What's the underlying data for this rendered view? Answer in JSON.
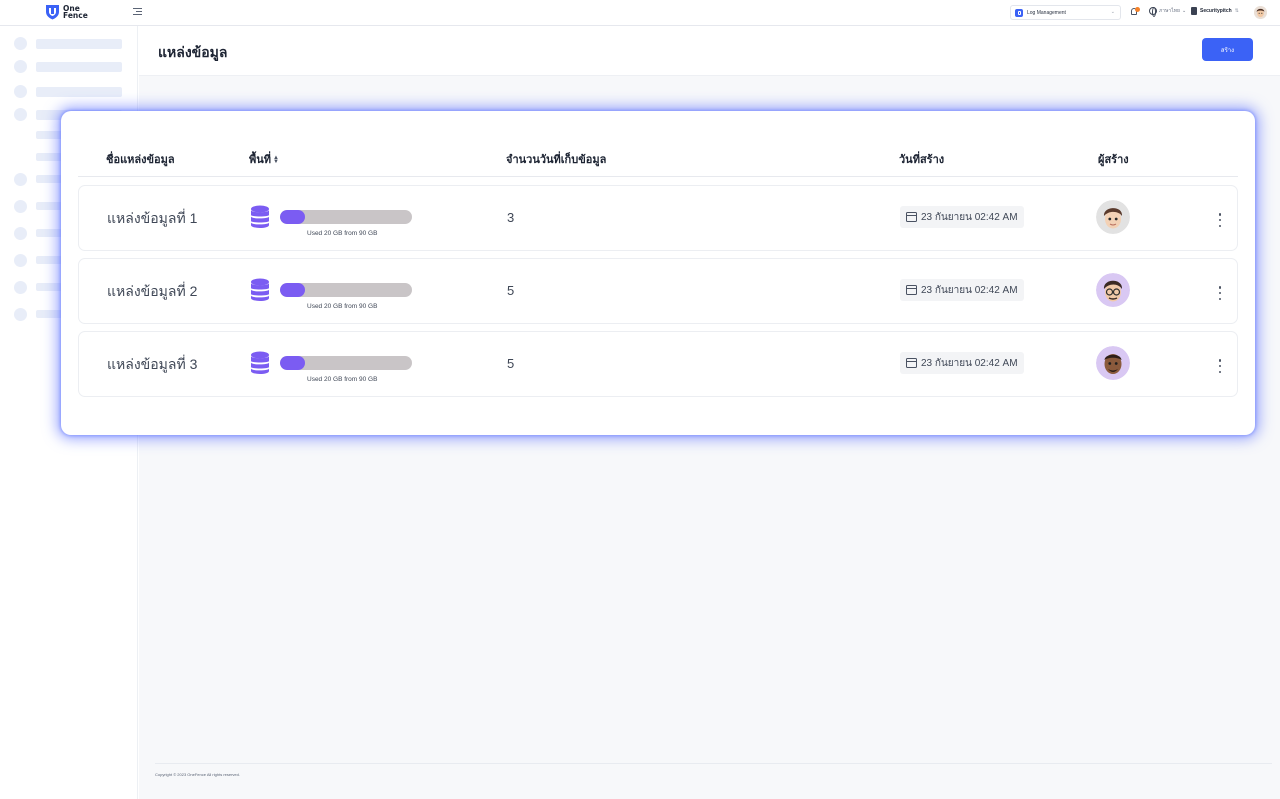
{
  "header": {
    "logo_text_1": "One",
    "logo_text_2": "Fence",
    "module_select": "Log Management",
    "language": "ภาษาไทย",
    "organization": "Securitypitch",
    "icons": [
      "menu-toggle-icon",
      "bell-icon",
      "globe-icon",
      "building-icon"
    ],
    "accent_color": "#3b62f6",
    "notification_color": "#f5822a"
  },
  "page": {
    "title": "แหล่งข้อมูล",
    "create_label": "สร้าง"
  },
  "table": {
    "columns": {
      "name": "ชื่อแหล่งข้อมูล",
      "space": "พื้นที่",
      "retention_days": "จำนวนวันที่เก็บข้อมูล",
      "created_date": "วันที่สร้าง",
      "creator": "ผู้สร้าง"
    },
    "rows": [
      {
        "name": "แหล่งข้อมูลที่ 1",
        "usage_caption": "Used 20 GB from 90 GB",
        "usage_fraction": 0.19,
        "days": "3",
        "created": "23 กันยายน 02:42 AM",
        "avatar": "avatar-1"
      },
      {
        "name": "แหล่งข้อมูลที่ 2",
        "usage_caption": "Used 20 GB from 90 GB",
        "usage_fraction": 0.19,
        "days": "5",
        "created": "23 กันยายน 02:42 AM",
        "avatar": "avatar-2"
      },
      {
        "name": "แหล่งข้อมูลที่ 3",
        "usage_caption": "Used 20 GB from 90 GB",
        "usage_fraction": 0.19,
        "days": "5",
        "created": "23 กันยายน 02:42 AM",
        "avatar": "avatar-3"
      }
    ],
    "usage_fill_color": "#7b5cf2",
    "usage_track_color": "#c9c5c7"
  },
  "footer": {
    "copyright": "Copyright © 2023 OneFence All rights reserved."
  }
}
